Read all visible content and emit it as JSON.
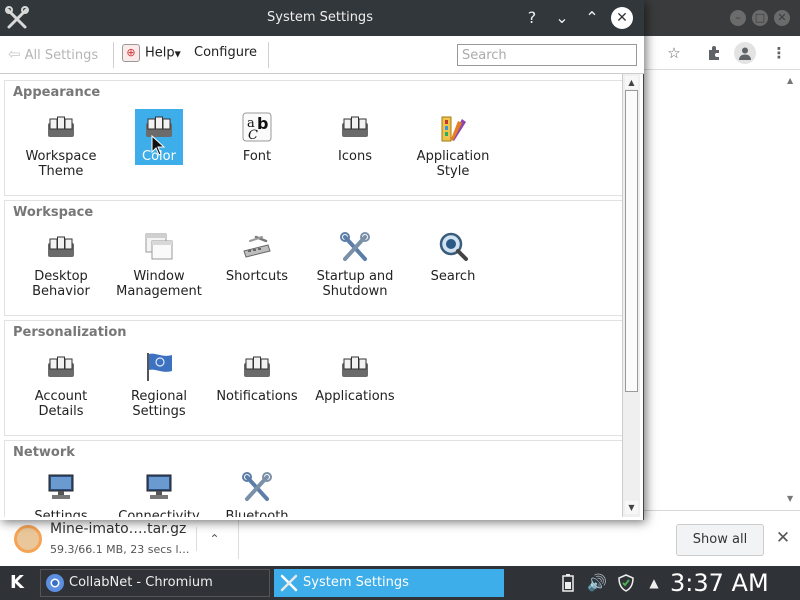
{
  "browser": {
    "download": {
      "filename": "Mine-imato….tar.gz",
      "status": "59.3/66.1 MB, 23 secs l…"
    },
    "show_all_label": "Show all"
  },
  "dialog": {
    "title": "System Settings",
    "toolbar": {
      "all_settings_label": "All Settings",
      "help_label": "Help",
      "configure_label": "Configure",
      "search_placeholder": "Search"
    },
    "sections": [
      {
        "title": "Appearance",
        "modules": [
          {
            "label": "Workspace Theme",
            "icon": "workspace-theme-icon"
          },
          {
            "label": "Color",
            "icon": "color-icon",
            "selected": true
          },
          {
            "label": "Font",
            "icon": "font-icon"
          },
          {
            "label": "Icons",
            "icon": "icons-icon"
          },
          {
            "label": "Application Style",
            "icon": "application-style-icon"
          }
        ]
      },
      {
        "title": "Workspace",
        "modules": [
          {
            "label": "Desktop Behavior",
            "icon": "desktop-behavior-icon"
          },
          {
            "label": "Window Management",
            "icon": "window-management-icon"
          },
          {
            "label": "Shortcuts",
            "icon": "shortcuts-icon"
          },
          {
            "label": "Startup and Shutdown",
            "icon": "startup-shutdown-icon"
          },
          {
            "label": "Search",
            "icon": "search-icon"
          }
        ]
      },
      {
        "title": "Personalization",
        "modules": [
          {
            "label": "Account Details",
            "icon": "account-details-icon"
          },
          {
            "label": "Regional Settings",
            "icon": "regional-settings-icon"
          },
          {
            "label": "Notifications",
            "icon": "notifications-icon"
          },
          {
            "label": "Applications",
            "icon": "applications-icon"
          }
        ]
      },
      {
        "title": "Network",
        "modules": [
          {
            "label": "Settings",
            "icon": "network-settings-icon"
          },
          {
            "label": "Connectivity",
            "icon": "connectivity-icon"
          },
          {
            "label": "Bluetooth",
            "icon": "bluetooth-icon"
          }
        ]
      }
    ]
  },
  "taskbar": {
    "tasks": [
      {
        "label": "CollabNet - Chromium",
        "icon": "chromium-icon"
      },
      {
        "label": "System Settings",
        "icon": "system-settings-icon",
        "active": true
      }
    ],
    "clock": "3:37 AM"
  },
  "colors": {
    "accent": "#3daee9",
    "titlebar": "#32373c",
    "taskbar": "#2f3236"
  }
}
